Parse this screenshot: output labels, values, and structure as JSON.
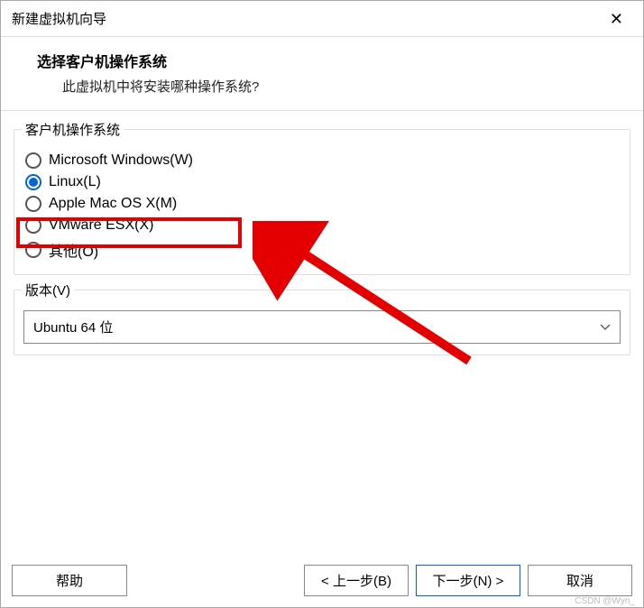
{
  "title": "新建虚拟机向导",
  "header": {
    "heading": "选择客户机操作系统",
    "subtext": "此虚拟机中将安装哪种操作系统?"
  },
  "os_group": {
    "title": "客户机操作系统",
    "options": [
      {
        "label": "Microsoft Windows(W)",
        "selected": false
      },
      {
        "label": "Linux(L)",
        "selected": true
      },
      {
        "label": "Apple Mac OS X(M)",
        "selected": false
      },
      {
        "label": "VMware ESX(X)",
        "selected": false
      },
      {
        "label": "其他(O)",
        "selected": false
      }
    ]
  },
  "version": {
    "label": "版本(V)",
    "selected": "Ubuntu 64 位"
  },
  "buttons": {
    "help": "帮助",
    "back": "< 上一步(B)",
    "next": "下一步(N) >",
    "cancel": "取消"
  },
  "watermark": "CSDN @Wyn_"
}
